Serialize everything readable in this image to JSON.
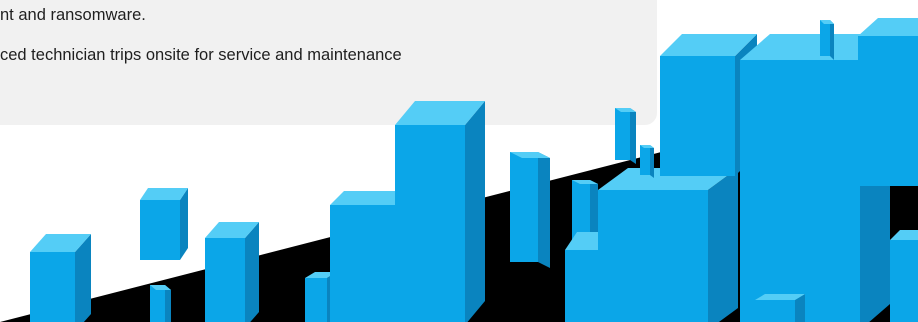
{
  "text_card": {
    "line_1": "nt and ransomware.",
    "line_2": "ced technician trips onsite for service and maintenance"
  },
  "illustration": {
    "name": "isometric-city-blocks-illustration",
    "colors": {
      "front": "#0ba6e8",
      "side": "#0a84bf",
      "top": "#54cdf6",
      "base": "#000000"
    }
  }
}
